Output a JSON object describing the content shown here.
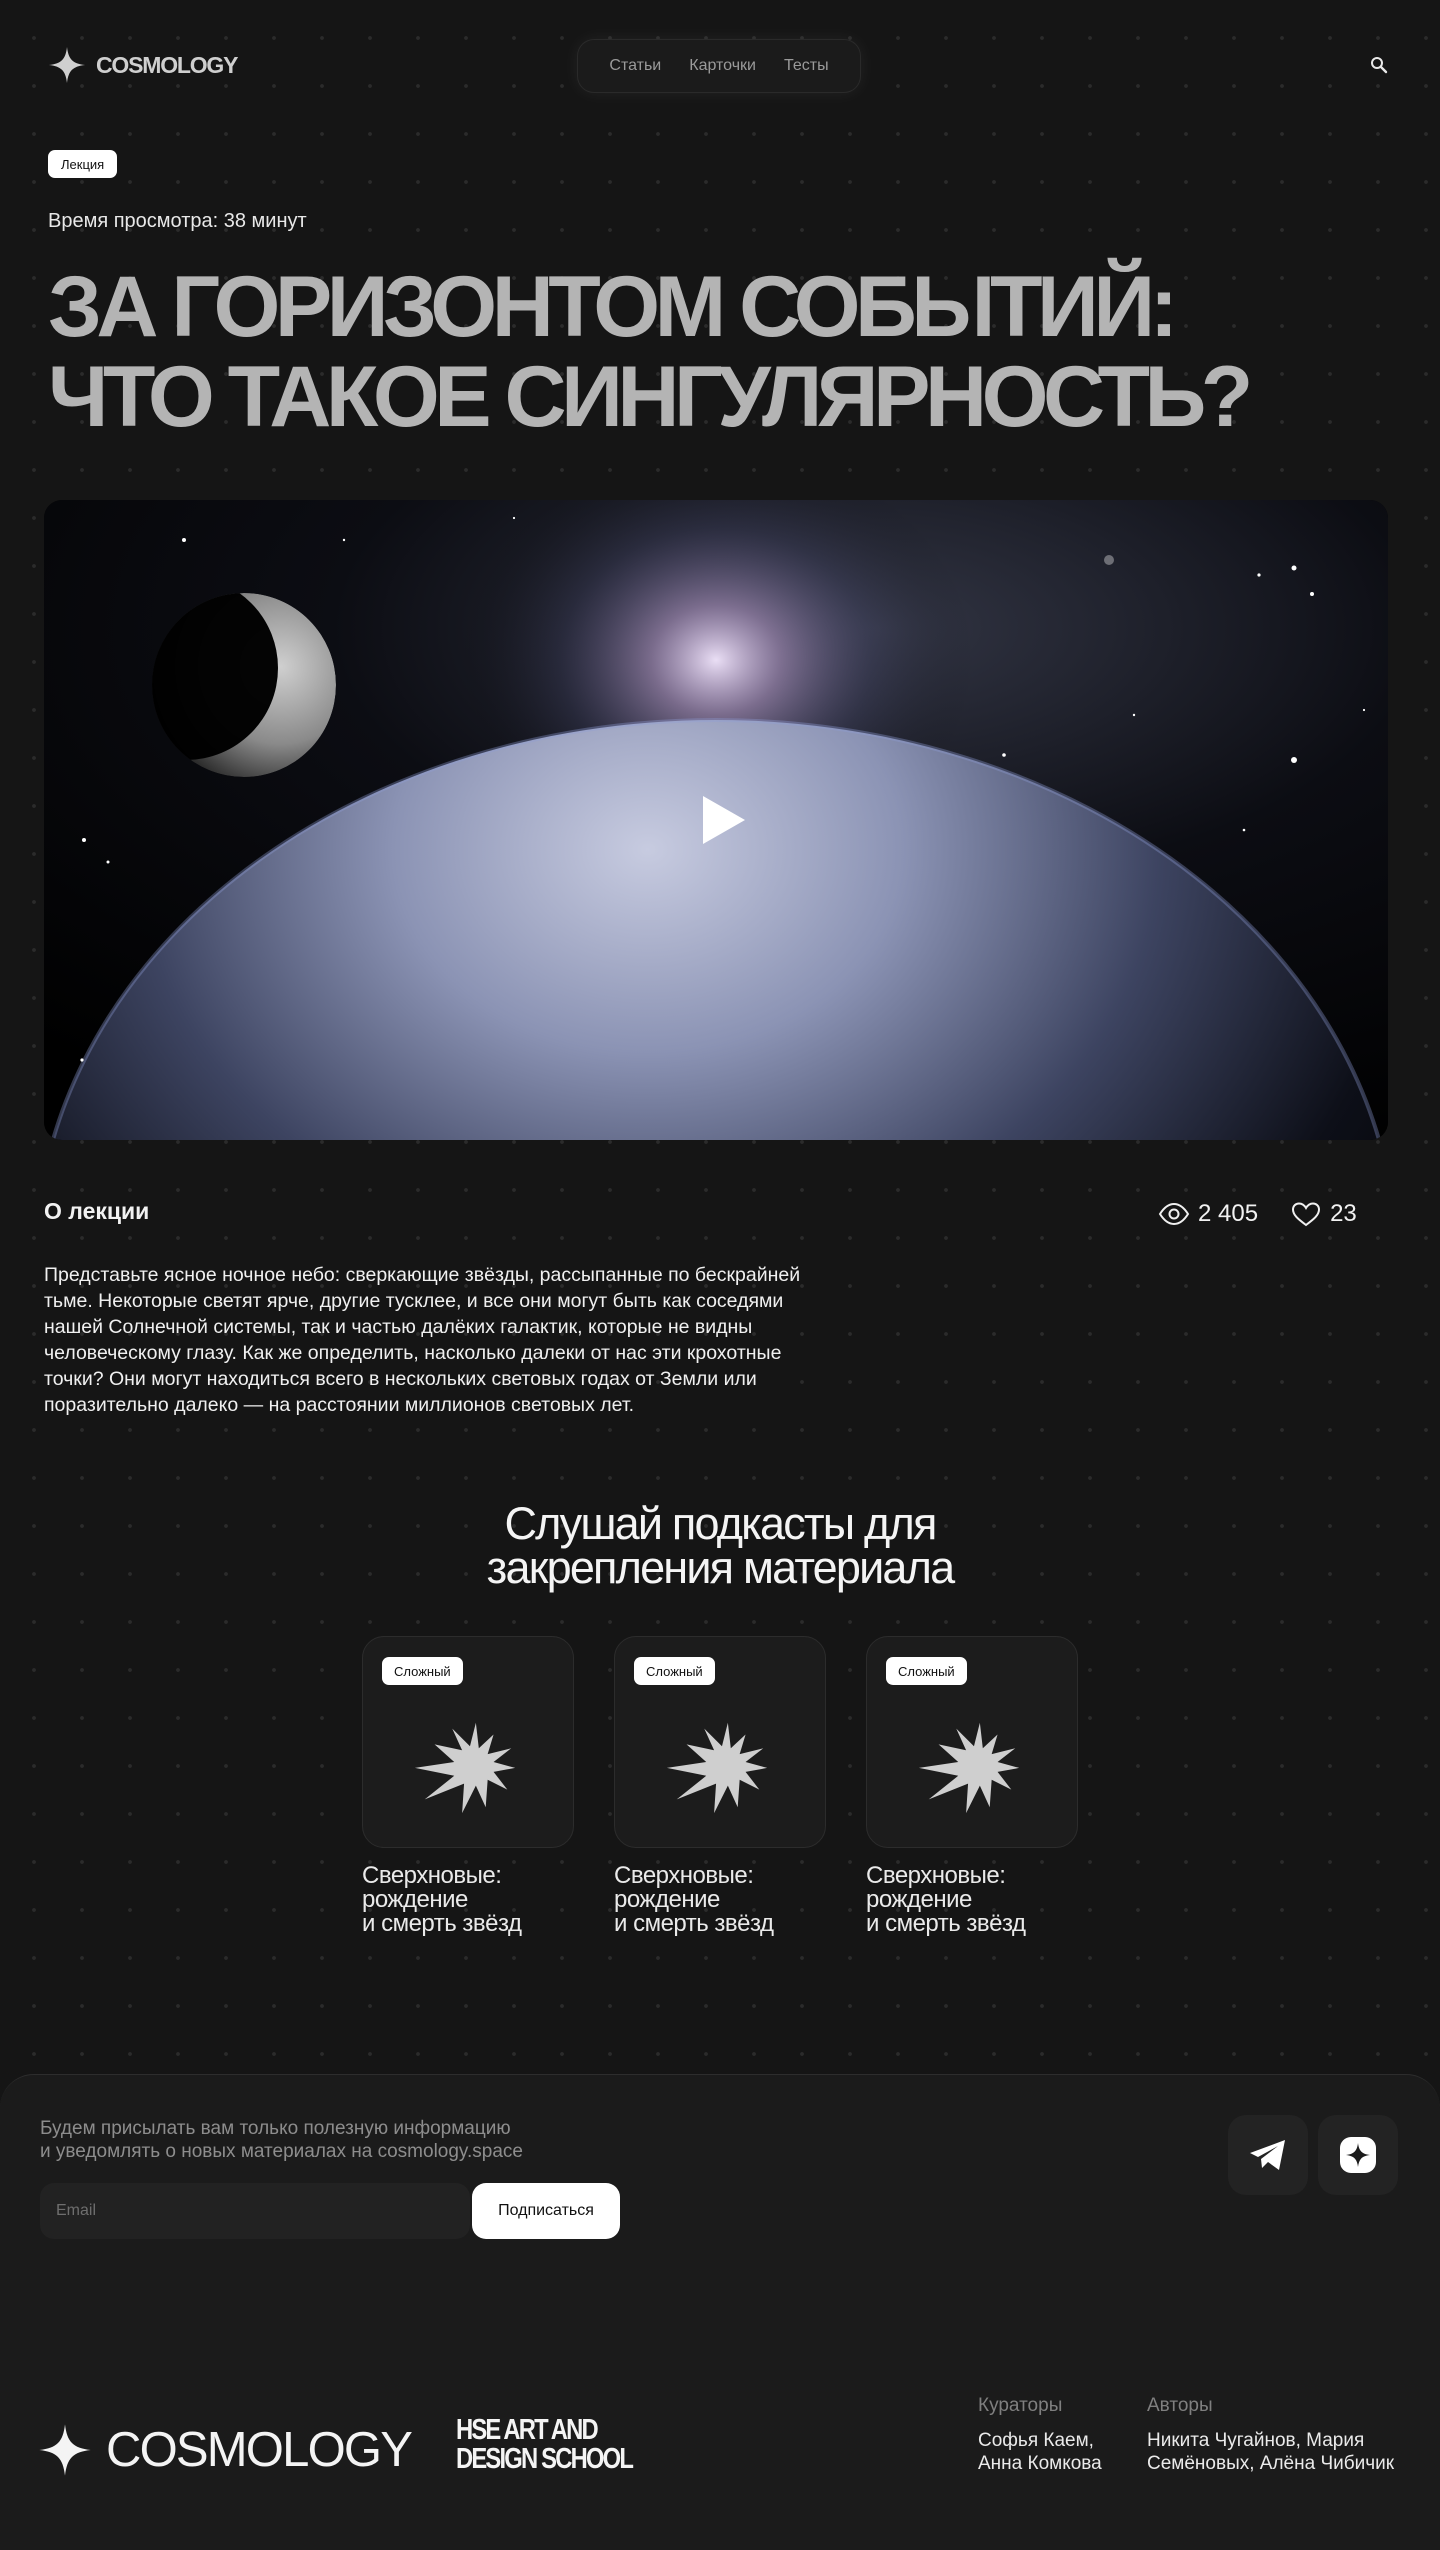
{
  "header": {
    "logo_text": "COSMOLOGY",
    "nav": [
      "Статьи",
      "Карточки",
      "Тесты"
    ]
  },
  "hero": {
    "tag": "Лекция",
    "watch_time": "Время просмотра: 38 минут",
    "title_line1": "ЗА ГОРИЗОНТОМ СОБЫТИЙ:",
    "title_line2": "ЧТО ТАКОЕ СИНГУЛЯРНОСТЬ?"
  },
  "about": {
    "title": "О лекции",
    "views": "2 405",
    "likes": "23",
    "text": "Представьте ясное ночное небо: сверкающие звёзды, рассыпанные по бескрайней тьме. Некоторые светят ярче, другие тусклее, и все они могут быть как соседями нашей Солнечной системы, так и частью далёких галактик, которые не видны человеческому глазу. Как же определить, насколько далеки от нас эти крохотные точки? Они могут находиться всего в нескольких световых годах от Земли или поразительно далеко — на расстоянии миллионов световых лет."
  },
  "podcasts": {
    "title_line1": "Слушай подкасты для",
    "title_line2": "закрепления материала",
    "cards": [
      {
        "tag": "Сложный",
        "title": "Сверхновые:\nрождение\nи смерть звёзд"
      },
      {
        "tag": "Сложный",
        "title": "Сверхновые:\nрождение\nи смерть звёзд"
      },
      {
        "tag": "Сложный",
        "title": "Сверхновые:\nрождение\nи смерть звёзд"
      }
    ]
  },
  "footer": {
    "note": "Будем присылать вам только полезную информацию\nи уведомлять о новых материалах на cosmology.space",
    "email_placeholder": "Email",
    "subscribe_label": "Подписаться",
    "logo_text": "COSMOLOGY",
    "school": "HSE ART AND\nDESIGN SCHOOL",
    "curators_label": "Кураторы",
    "curators": "Софья Каем,\nАнна Комкова",
    "authors_label": "Авторы",
    "authors": "Никита Чугайнов, Мария\nСемёновых, Алёна Чибичик"
  },
  "colors": {
    "background": "#151515",
    "title": "#b4b4b4",
    "footer": "#1b1b1b",
    "accent_white": "#ffffff"
  },
  "icons": [
    "four-point-star-icon",
    "search-icon",
    "play-icon",
    "eye-icon",
    "heart-icon",
    "supernova-icon",
    "telegram-icon",
    "sparkle-icon"
  ]
}
